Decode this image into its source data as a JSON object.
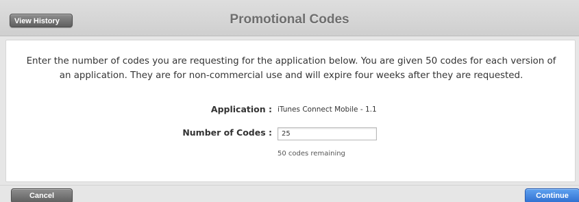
{
  "header": {
    "title": "Promotional Codes",
    "view_history_label": "View History"
  },
  "main": {
    "intro_text": "Enter the number of codes you are requesting for the application below. You are given 50 codes for each version of an application. They are for non-commercial use and will expire four weeks after they are requested.",
    "application_label": "Application :",
    "application_value": "iTunes Connect Mobile - 1.1",
    "number_label": "Number of Codes :",
    "number_value": "25",
    "remaining_text": "50 codes remaining"
  },
  "footer": {
    "cancel_label": "Cancel",
    "continue_label": "Continue"
  },
  "colors": {
    "accent_blue": "#2f6fd0",
    "gray_button": "#6f6f6f",
    "header_bg": "#d6d6d6",
    "title_text": "#6e6e6e"
  }
}
